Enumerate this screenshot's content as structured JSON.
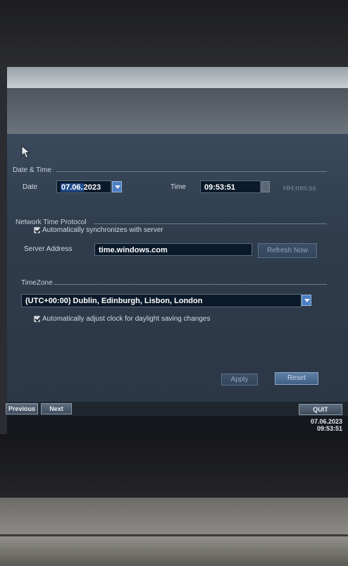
{
  "date_time": {
    "section_title": "Date & Time",
    "date_label": "Date",
    "date_day_month": "07.06.",
    "date_year": "2023",
    "time_label": "Time",
    "time_value": "09:53:51",
    "time_format_hint": "HH:mm:ss"
  },
  "ntp": {
    "section_title": "Network Time Protocol",
    "auto_sync_label": "Automatically synchronizes with server",
    "auto_sync_checked": true,
    "server_address_label": "Server Address",
    "server_address_value": "time.windows.com",
    "refresh_button": "Refresh Now"
  },
  "timezone": {
    "section_title": "TimeZone",
    "selected": "(UTC+00:00) Dublin, Edinburgh, Lisbon, London",
    "dst_label": "Automatically adjust clock for daylight saving changes",
    "dst_checked": true
  },
  "actions": {
    "apply_button": "Apply",
    "reset_button": "Reset"
  },
  "nav": {
    "previous_button": "Previous",
    "next_button": "Next",
    "quit_button": "QUIT"
  },
  "status": {
    "date": "07.06.2023",
    "time": "09:53:51"
  },
  "colors": {
    "panel_background": "#2e3c4c",
    "field_background": "#0b1a2a",
    "button_accent": "#4b7dc2"
  }
}
